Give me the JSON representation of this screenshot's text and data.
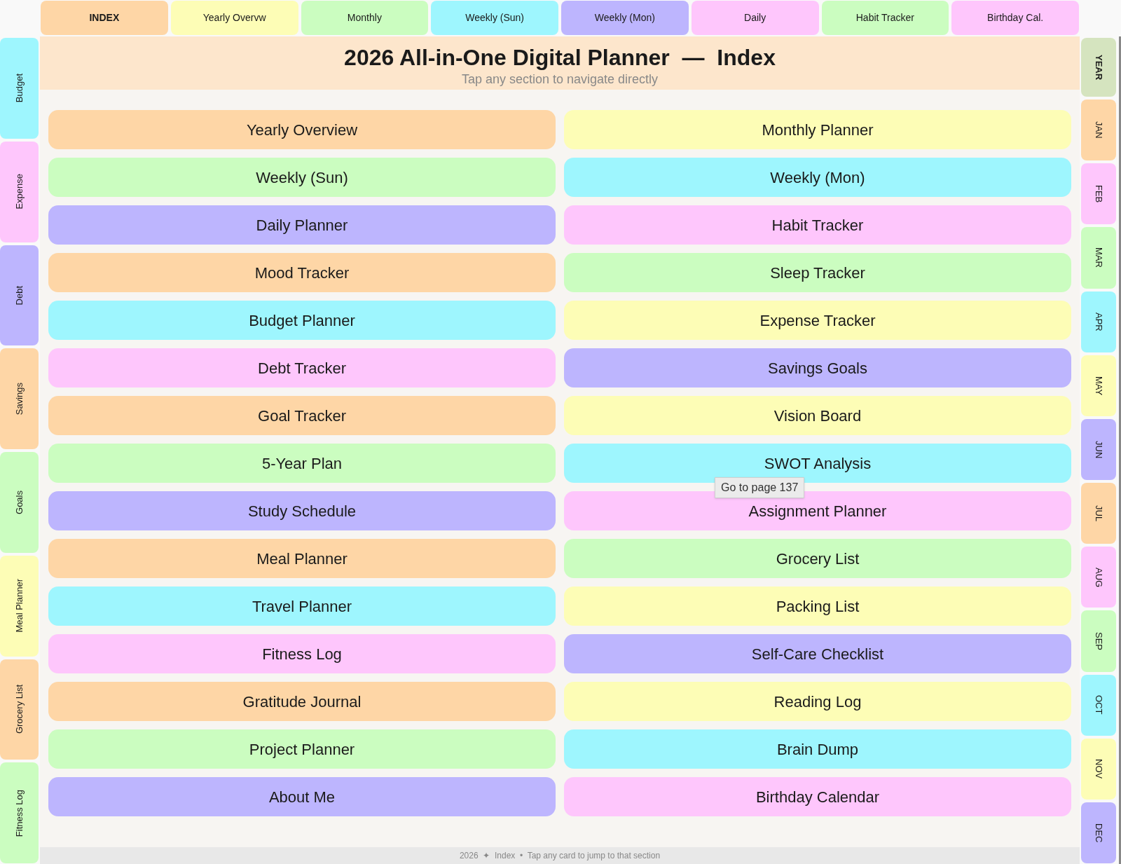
{
  "top_tabs": [
    {
      "label": "INDEX",
      "selected": true,
      "color": "#fed6a6"
    },
    {
      "label": "Yearly Overvw",
      "selected": false,
      "color": "#fdfdb6"
    },
    {
      "label": "Monthly",
      "selected": false,
      "color": "#cbfdc0"
    },
    {
      "label": "Weekly (Sun)",
      "selected": false,
      "color": "#9ef6fe"
    },
    {
      "label": "Weekly (Mon)",
      "selected": false,
      "color": "#bdb5fe"
    },
    {
      "label": "Daily",
      "selected": false,
      "color": "#fec6fc"
    },
    {
      "label": "Habit Tracker",
      "selected": false,
      "color": "#cbfdc0"
    },
    {
      "label": "Birthday Cal.",
      "selected": false,
      "color": "#fec6fc"
    }
  ],
  "side_tabs": [
    {
      "label": "Budget",
      "color": "#9ef6fe"
    },
    {
      "label": "Expense",
      "color": "#fec6fc"
    },
    {
      "label": "Debt",
      "color": "#bdb5fe"
    },
    {
      "label": "Savings",
      "color": "#fed6a6"
    },
    {
      "label": "Goals",
      "color": "#cbfdc0"
    },
    {
      "label": "Meal Planner",
      "color": "#fdfdb6"
    },
    {
      "label": "Grocery List",
      "color": "#fed6a6"
    },
    {
      "label": "Fitness Log",
      "color": "#cbfdc0"
    }
  ],
  "month_tabs": [
    {
      "label": "YEAR",
      "selected": true,
      "color": "#d5e4bf"
    },
    {
      "label": "JAN",
      "selected": false,
      "color": "#fed6a6"
    },
    {
      "label": "FEB",
      "selected": false,
      "color": "#fec6fc"
    },
    {
      "label": "MAR",
      "selected": false,
      "color": "#cbfdc0"
    },
    {
      "label": "APR",
      "selected": false,
      "color": "#9ef6fe"
    },
    {
      "label": "MAY",
      "selected": false,
      "color": "#fdfdb6"
    },
    {
      "label": "JUN",
      "selected": false,
      "color": "#bdb5fe"
    },
    {
      "label": "JUL",
      "selected": false,
      "color": "#fed6a6"
    },
    {
      "label": "AUG",
      "selected": false,
      "color": "#fec6fc"
    },
    {
      "label": "SEP",
      "selected": false,
      "color": "#cbfdc0"
    },
    {
      "label": "OCT",
      "selected": false,
      "color": "#9ef6fe"
    },
    {
      "label": "NOV",
      "selected": false,
      "color": "#fdfdb6"
    },
    {
      "label": "DEC",
      "selected": false,
      "color": "#bdb5fe"
    }
  ],
  "header": {
    "title": "2026 All-in-One Digital Planner  —  Index",
    "subtitle": "Tap any section to navigate directly"
  },
  "cards": [
    {
      "label": "Yearly Overview",
      "color": "#fed6a6"
    },
    {
      "label": "Monthly Planner",
      "color": "#fdfdb6"
    },
    {
      "label": "Weekly (Sun)",
      "color": "#cbfdc0"
    },
    {
      "label": "Weekly (Mon)",
      "color": "#9ef6fe"
    },
    {
      "label": "Daily Planner",
      "color": "#bdb5fe"
    },
    {
      "label": "Habit Tracker",
      "color": "#fec6fc"
    },
    {
      "label": "Mood Tracker",
      "color": "#fed6a6"
    },
    {
      "label": "Sleep Tracker",
      "color": "#cbfdc0"
    },
    {
      "label": "Budget Planner",
      "color": "#9ef6fe"
    },
    {
      "label": "Expense Tracker",
      "color": "#fdfdb6"
    },
    {
      "label": "Debt Tracker",
      "color": "#fec6fc"
    },
    {
      "label": "Savings Goals",
      "color": "#bdb5fe"
    },
    {
      "label": "Goal Tracker",
      "color": "#fed6a6"
    },
    {
      "label": "Vision Board",
      "color": "#fdfdb6"
    },
    {
      "label": "5-Year Plan",
      "color": "#cbfdc0"
    },
    {
      "label": "SWOT Analysis",
      "color": "#9ef6fe",
      "tooltip": "Go to page 137"
    },
    {
      "label": "Study Schedule",
      "color": "#bdb5fe"
    },
    {
      "label": "Assignment Planner",
      "color": "#fec6fc"
    },
    {
      "label": "Meal Planner",
      "color": "#fed6a6"
    },
    {
      "label": "Grocery List",
      "color": "#cbfdc0"
    },
    {
      "label": "Travel Planner",
      "color": "#9ef6fe"
    },
    {
      "label": "Packing List",
      "color": "#fdfdb6"
    },
    {
      "label": "Fitness Log",
      "color": "#fec6fc"
    },
    {
      "label": "Self-Care Checklist",
      "color": "#bdb5fe"
    },
    {
      "label": "Gratitude Journal",
      "color": "#fed6a6"
    },
    {
      "label": "Reading Log",
      "color": "#fdfdb6"
    },
    {
      "label": "Project Planner",
      "color": "#cbfdc0"
    },
    {
      "label": "Brain Dump",
      "color": "#9ef6fe"
    },
    {
      "label": "About Me",
      "color": "#bdb5fe"
    },
    {
      "label": "Birthday Calendar",
      "color": "#fec6fc"
    }
  ],
  "footer": "2026  ✦  Index  •  Tap any card to jump to that section"
}
